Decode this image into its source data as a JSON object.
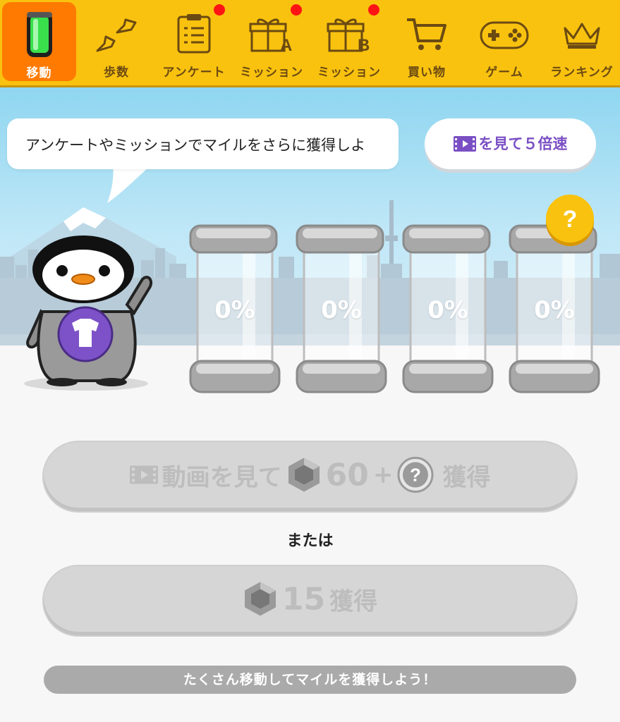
{
  "nav": {
    "items": [
      {
        "label": "移動",
        "icon": "battery-icon",
        "active": true
      },
      {
        "label": "歩数",
        "icon": "footprints-icon"
      },
      {
        "label": "アンケート",
        "icon": "clipboard-icon",
        "badge": true
      },
      {
        "label": "ミッション",
        "icon": "gift-a-icon",
        "badge": true
      },
      {
        "label": "ミッション",
        "icon": "gift-b-icon",
        "badge": true
      },
      {
        "label": "買い物",
        "icon": "cart-icon"
      },
      {
        "label": "ゲーム",
        "icon": "gamepad-icon"
      },
      {
        "label": "ランキング",
        "icon": "crown-icon"
      }
    ]
  },
  "speech": {
    "text": "アンケートやミッションでマイルをさらに獲得しよ"
  },
  "speed_button": {
    "label": "を見て５倍速"
  },
  "capsules": [
    {
      "percent": "0%"
    },
    {
      "percent": "0%"
    },
    {
      "percent": "0%"
    },
    {
      "percent": "0%"
    }
  ],
  "question_badge": "?",
  "video_button": {
    "prefix": "動画を見て",
    "amount": "60",
    "plus": "+",
    "suffix": "獲得",
    "mystery": "?"
  },
  "or_text": "または",
  "gem_button": {
    "amount": "15",
    "suffix": "獲得"
  },
  "footer": {
    "text": "たくさん移動してマイルを獲得しよう！"
  },
  "colors": {
    "nav_bg": "#f9c20f",
    "active_tab": "#ff7a00",
    "accent_purple": "#7a4fc4",
    "badge": "#ff1414"
  }
}
